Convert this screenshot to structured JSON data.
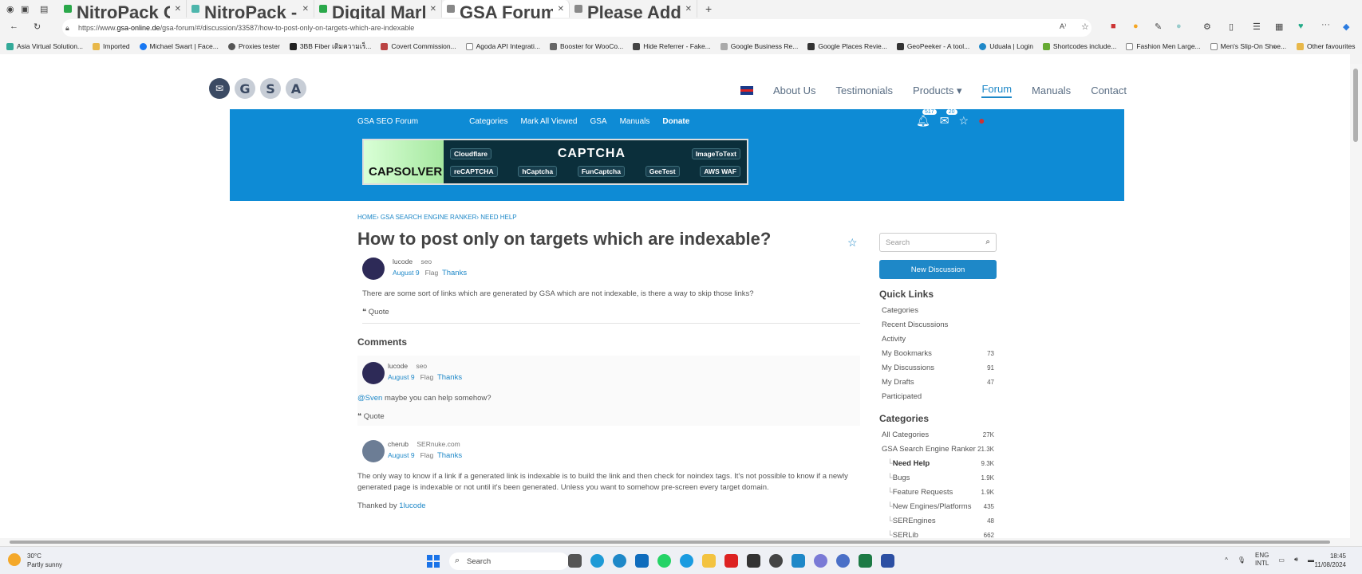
{
  "browser": {
    "tabs": [
      {
        "title": "NitroPack Options ‹ Asia Virtual",
        "color": "#2aa84a"
      },
      {
        "title": "NitroPack - Improve your Google",
        "color": "#4db6ac"
      },
      {
        "title": "Digital Marketing Services and Ex",
        "color": "#2aa84a"
      },
      {
        "title": "GSA Forum",
        "color": "#888888",
        "active": true
      },
      {
        "title": "Please Add — GSA SEO Forum",
        "color": "#888888"
      }
    ],
    "url_prefix": "https://www.",
    "url_domain": "gsa-online.de",
    "url_path": "/gsa-forum/#/discussion/33587/how-to-post-only-on-targets-which-are-indexable",
    "bookmarks": [
      "Asia Virtual Solution...",
      "Imported",
      "Michael Swart | Face...",
      "Proxies tester",
      "3BB Fiber เติมความเร็...",
      "Covert Commission...",
      "Agoda API Integrati...",
      "Booster for WooCo...",
      "Hide Referrer - Fake...",
      "Google Business Re...",
      "Google Places Revie...",
      "GeoPeeker - A tool...",
      "Uduala | Login",
      "Shortcodes include...",
      "Fashion Men Large...",
      "Men's Slip-On Shoe..."
    ],
    "other_favourites": "Other favourites"
  },
  "site": {
    "logo_letters": [
      "G",
      "S",
      "A"
    ],
    "nav": [
      "About Us",
      "Testimonials",
      "Products ▾",
      "Forum",
      "Manuals",
      "Contact"
    ],
    "nav_active": "Forum",
    "subnav": {
      "home": "GSA SEO Forum",
      "items": [
        "Categories",
        "Mark All Viewed",
        "GSA",
        "Manuals"
      ],
      "donate": "Donate"
    },
    "notif_count": "517",
    "inbox_count": "20",
    "ad": {
      "brand": "CAPSOLVER",
      "cloudflare": "Cloudflare",
      "captcha": "CAPTCHA",
      "imagetotext": "ImageToText",
      "chips": [
        "reCAPTCHA",
        "hCaptcha",
        "FunCaptcha",
        "GeeTest",
        "AWS WAF"
      ]
    }
  },
  "discussion": {
    "breadcrumb": [
      "HOME",
      "GSA SEARCH ENGINE RANKER",
      "NEED HELP"
    ],
    "title": "How to post only on targets which are indexable?",
    "post": {
      "user": "lucode",
      "role": "seo",
      "date": "August 9",
      "flag": "Flag",
      "thanks": "Thanks",
      "body": "There are some sort of links which are generated by GSA which are not indexable, is there a way to skip those links?",
      "quote": "Quote"
    },
    "comments_heading": "Comments",
    "comments": [
      {
        "user": "lucode",
        "role": "seo",
        "date": "August 9",
        "flag": "Flag",
        "thanks": "Thanks",
        "mention": "@Sven",
        "body": " maybe you can help somehow?",
        "quote": "Quote"
      },
      {
        "user": "cherub",
        "role": "SERnuke.com",
        "date": "August 9",
        "flag": "Flag",
        "thanks": "Thanks",
        "body": "The only way to know if a link if a generated link is indexable is to build the link and then check for noindex tags. It's not possible to know if a newly generated page is indexable or not until it's been generated. Unless you want to somehow pre-screen every target domain.",
        "thanked_label": "Thanked by ",
        "thanked_user": "1lucode"
      }
    ]
  },
  "sidebar": {
    "search_placeholder": "Search",
    "new_discussion": "New Discussion",
    "quick_links_heading": "Quick Links",
    "quick_links": [
      {
        "label": "Categories",
        "count": ""
      },
      {
        "label": "Recent Discussions",
        "count": ""
      },
      {
        "label": "Activity",
        "count": ""
      },
      {
        "label": "My Bookmarks",
        "count": "73"
      },
      {
        "label": "My Discussions",
        "count": "91"
      },
      {
        "label": "My Drafts",
        "count": "47"
      },
      {
        "label": "Participated",
        "count": ""
      }
    ],
    "categories_heading": "Categories",
    "categories": [
      {
        "label": "All Categories",
        "count": "27K",
        "sub": false,
        "bold": false
      },
      {
        "label": "GSA Search Engine Ranker",
        "count": "21.3K",
        "sub": false,
        "bold": false
      },
      {
        "label": "Need Help",
        "count": "9.3K",
        "sub": true,
        "bold": true
      },
      {
        "label": "Bugs",
        "count": "1.9K",
        "sub": true,
        "bold": false
      },
      {
        "label": "Feature Requests",
        "count": "1.9K",
        "sub": true,
        "bold": false
      },
      {
        "label": "New Engines/Platforms",
        "count": "435",
        "sub": true,
        "bold": false
      },
      {
        "label": "SEREngines",
        "count": "48",
        "sub": true,
        "bold": false
      },
      {
        "label": "SERLib",
        "count": "662",
        "sub": true,
        "bold": false
      }
    ]
  },
  "taskbar": {
    "temp": "30°C",
    "weather": "Partly sunny",
    "search": "Search",
    "lang1": "ENG",
    "lang2": "INTL",
    "time": "18:45",
    "date": "11/08/2024"
  }
}
